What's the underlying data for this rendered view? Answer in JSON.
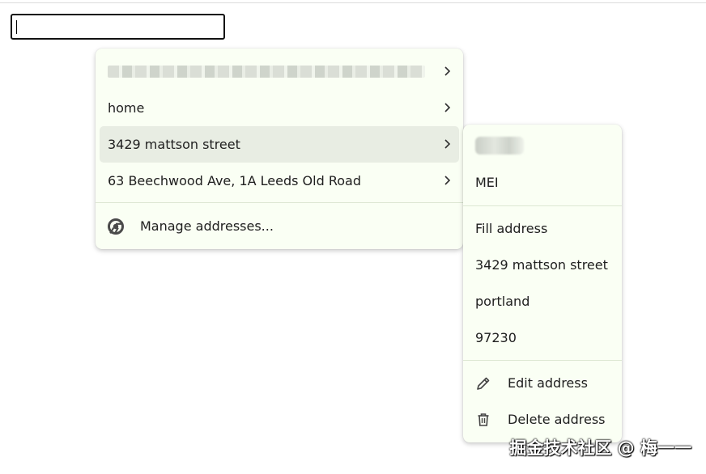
{
  "input": {
    "value": ""
  },
  "main_menu": {
    "items": [
      {
        "label": "",
        "blurred": true
      },
      {
        "label": "home"
      },
      {
        "label": "3429 mattson street",
        "selected": true
      },
      {
        "label": "63 Beechwood Ave, 1A Leeds Old Road"
      }
    ],
    "manage_label": "Manage addresses..."
  },
  "sub_menu": {
    "name_blurred": true,
    "name": "MEI",
    "fill_label": "Fill address",
    "street": "3429 mattson street",
    "city": "portland",
    "zip": "97230",
    "edit_label": "Edit address",
    "delete_label": "Delete address"
  },
  "icons": {
    "chevron": "chevron-right-icon",
    "manage": "chrome-icon",
    "edit": "pencil-icon",
    "delete": "trash-icon"
  },
  "colors": {
    "menu_bg": "#fafff4",
    "selected_bg": "#e8ede3",
    "separator": "#dde7d3",
    "text": "#202020"
  },
  "watermark": "掘金技术社区 @ 梅一一"
}
